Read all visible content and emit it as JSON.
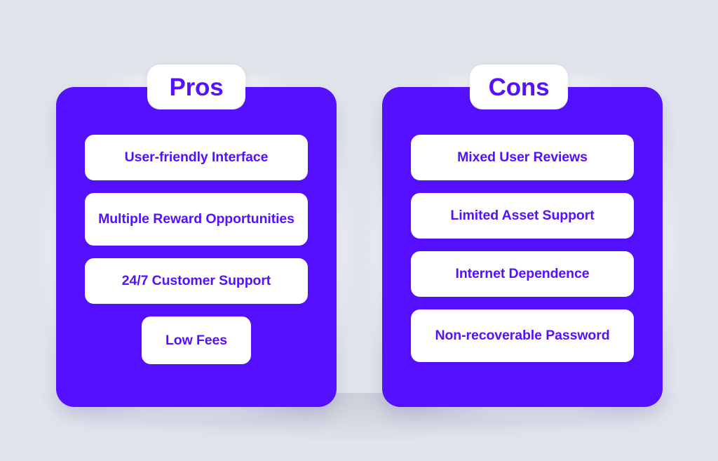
{
  "theme": {
    "background": "#e1e5eb",
    "panel": "#5511ff",
    "card": "#ffffff",
    "text_accent": "#5511ff"
  },
  "columns": [
    {
      "id": "pros",
      "title": "Pros",
      "items": [
        {
          "label": "User-friendly Interface",
          "lines": 1,
          "narrow": false
        },
        {
          "label": "Multiple Reward Opportunities",
          "lines": 2,
          "narrow": false
        },
        {
          "label": "24/7 Customer Support",
          "lines": 1,
          "narrow": false
        },
        {
          "label": "Low Fees",
          "lines": 1,
          "narrow": true
        }
      ]
    },
    {
      "id": "cons",
      "title": "Cons",
      "items": [
        {
          "label": "Mixed User Reviews",
          "lines": 1,
          "narrow": false
        },
        {
          "label": "Limited Asset Support",
          "lines": 1,
          "narrow": false
        },
        {
          "label": "Internet Dependence",
          "lines": 1,
          "narrow": false
        },
        {
          "label": "Non-recoverable Password",
          "lines": 2,
          "narrow": false
        }
      ]
    }
  ]
}
